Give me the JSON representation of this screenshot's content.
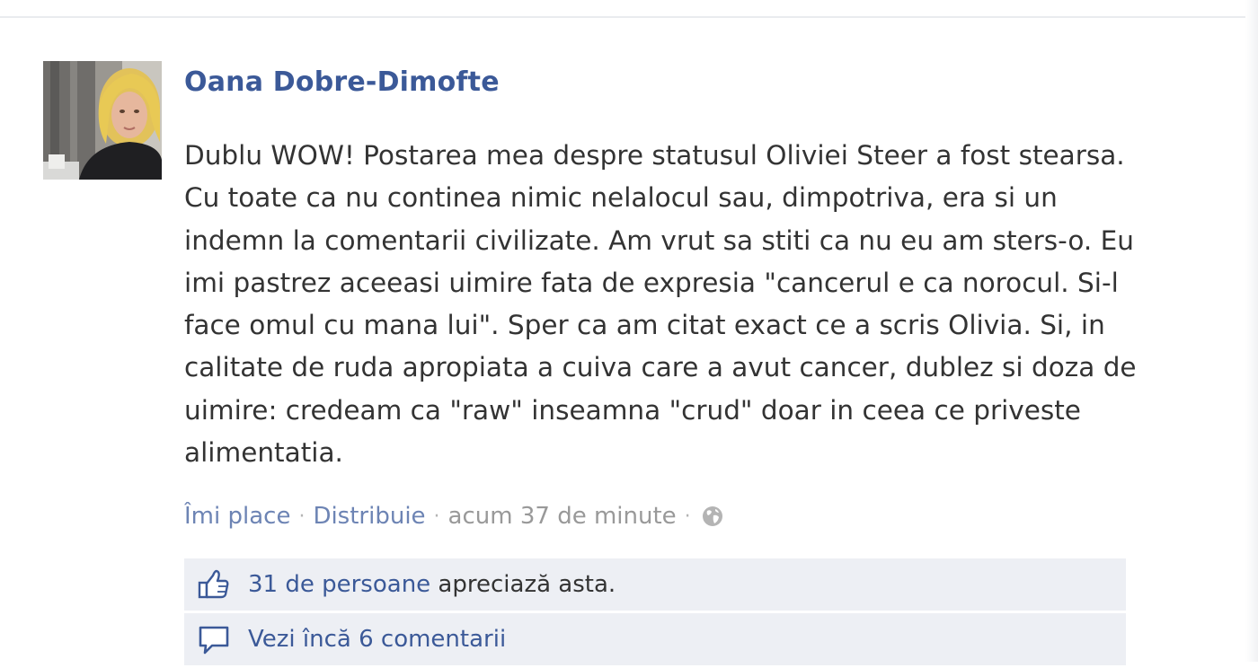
{
  "post": {
    "author": "Oana Dobre-Dimofte",
    "message_lines": [
      "Dublu WOW! Postarea mea despre statusul Oliviei Steer a fost stearsa.",
      "Cu toate ca nu continea nimic nelalocul sau, dimpotriva, era si un",
      "indemn la comentarii civilizate. Am vrut sa stiti ca nu eu am sters-o. Eu",
      "imi pastrez aceeasi uimire fata de expresia \"cancerul e ca norocul. Si-l",
      "face omul cu mana lui\". Sper ca am citat exact ce a scris Olivia. Si, in",
      "calitate de ruda apropiata a cuiva care a avut cancer, dublez si doza de",
      "uimire: credeam ca \"raw\" inseamna \"crud\" doar in ceea ce priveste",
      "alimentatia."
    ],
    "actions": {
      "like_label": "Îmi place",
      "share_label": "Distribuie",
      "timestamp": "acum 37 de minute",
      "separator": "·",
      "privacy_icon": "globe-icon"
    },
    "likes": {
      "icon": "thumbs-up-icon",
      "count_link": "31 de persoane",
      "suffix": " apreciază asta."
    },
    "comments": {
      "icon": "comment-bubble-icon",
      "more_link": "Vezi încă 6 comentarii"
    }
  },
  "colors": {
    "author_link": "#3b5998",
    "action_link": "#6d84b4",
    "meta_text": "#999999",
    "ufi_background": "#edeff4"
  }
}
